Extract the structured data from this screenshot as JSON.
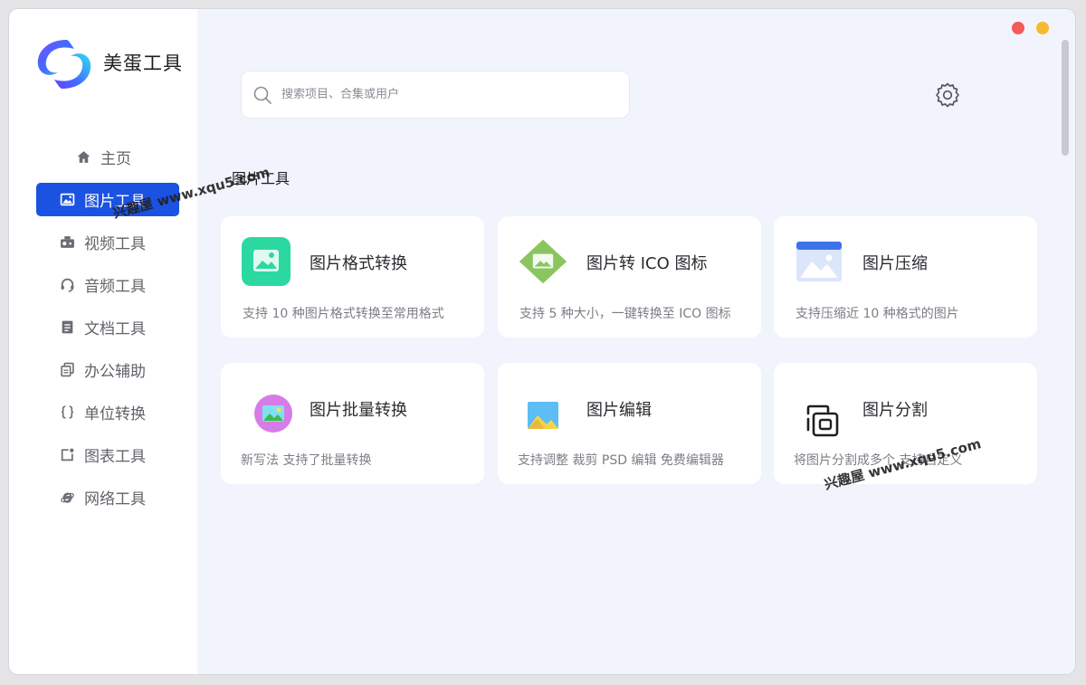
{
  "app": {
    "name": "美蛋工具"
  },
  "sidebar": {
    "items": [
      {
        "label": "主页",
        "icon": "home-icon"
      },
      {
        "label": "图片工具",
        "icon": "image-icon",
        "active": true
      },
      {
        "label": "视频工具",
        "icon": "video-icon"
      },
      {
        "label": "音频工具",
        "icon": "headphones-icon"
      },
      {
        "label": "文档工具",
        "icon": "document-icon"
      },
      {
        "label": "办公辅助",
        "icon": "copy-icon"
      },
      {
        "label": "单位转换",
        "icon": "braces-icon"
      },
      {
        "label": "图表工具",
        "icon": "chart-icon"
      },
      {
        "label": "网络工具",
        "icon": "ie-icon"
      }
    ]
  },
  "search": {
    "placeholder": "搜索项目、合集或用户"
  },
  "section": {
    "title": "图片工具"
  },
  "cards": [
    {
      "title": "图片格式转换",
      "desc": "支持 10 种图片格式转换至常用格式",
      "icon": "green-image-icon"
    },
    {
      "title": "图片转 ICO 图标",
      "desc": "支持 5 种大小，一键转换至 ICO 图标",
      "icon": "diamond-image-icon"
    },
    {
      "title": "图片压缩",
      "desc": "支持压缩近 10 种格式的图片",
      "icon": "blue-image-icon"
    },
    {
      "title": "图片批量转换",
      "desc": "新写法 支持了批量转换",
      "icon": "batch-image-icon"
    },
    {
      "title": "图片编辑",
      "desc": "支持调整 裁剪 PSD 编辑  免费编辑器",
      "icon": "edit-image-icon"
    },
    {
      "title": "图片分割",
      "desc": "将图片分割成多个 支持自定义",
      "icon": "split-icon"
    }
  ],
  "watermarks": [
    "兴趣屋 www.xqu5.com",
    "兴趣屋 www.xqu5.com"
  ],
  "colors": {
    "accent": "#1b52e2",
    "close": "#f35a58",
    "minimize": "#f6bb2d"
  }
}
